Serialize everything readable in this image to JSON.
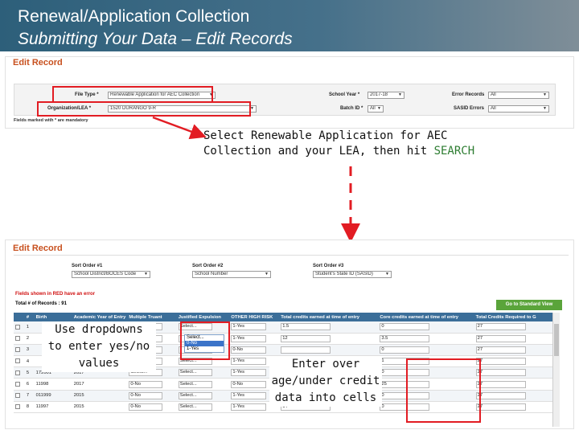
{
  "header": {
    "title": "Renewal/Application Collection",
    "subtitle": "Submitting Your Data – Edit Records"
  },
  "top": {
    "title": "Edit Record",
    "file_type_label": "File Type *",
    "file_type_value": "Renewable Application for AEC Collection",
    "org_label": "Organization/LEA *",
    "org_value": "1520 DURANGO 9-R",
    "school_year_label": "School Year *",
    "school_year_value": "2017-18",
    "batch_label": "Batch ID *",
    "batch_value": "All",
    "error_label": "Error Records",
    "error_value": "All",
    "sasid_label": "SASID Errors",
    "sasid_value": "All",
    "mandatory": "Fields marked with * are mandatory"
  },
  "callout": {
    "line1": "Select Renewable Application for AEC",
    "line2_pre": "Collection and your LEA, then hit ",
    "line2_kw": "SEARCH"
  },
  "bottom": {
    "title": "Edit Record",
    "sort1_label": "Sort Order #1",
    "sort1_value": "School District/BOCES Code",
    "sort2_label": "Sort Order #2",
    "sort2_value": "School Number",
    "sort3_label": "Sort Order #3",
    "sort3_value": "Student's State ID (SASID)",
    "err_msg": "Fields shown in RED have an error",
    "total": "Total # of Records : 91",
    "std_btn": "Go to Standard View",
    "columns": [
      "",
      "#",
      "Birth",
      "Academic Year of Entry",
      "Multiple Truant",
      "Justified Expulsion",
      "OTHER HIGH RISK",
      "Total credits earned at time of entry",
      "Core credits earned at time of entry",
      "Total Credits Required to G"
    ],
    "dropdown_options": [
      "Select...",
      "Select...",
      "0-No",
      "1-Yes"
    ],
    "rows": [
      {
        "n": "1",
        "birth": "",
        "year": "",
        "truant": "",
        "expul": "Select...",
        "risk": "1-Yes",
        "tot": "1.5",
        "core": "0",
        "req": "27"
      },
      {
        "n": "2",
        "birth": "",
        "year": "",
        "truant": "",
        "expul": "",
        "risk": "1-Yes",
        "tot": "12",
        "core": "3.5",
        "req": "27"
      },
      {
        "n": "3",
        "birth": "",
        "year": "",
        "truant": "",
        "expul": "",
        "risk": "0-No",
        "tot": "",
        "core": "0",
        "req": "27"
      },
      {
        "n": "4",
        "birth": "",
        "year": "",
        "truant": "",
        "expul": "Select...",
        "risk": "1-Yes",
        "tot": "",
        "core": "1",
        "req": "27"
      },
      {
        "n": "5",
        "birth": "172001",
        "year": "2017",
        "truant": "Select...",
        "expul": "Select...",
        "risk": "1-Yes",
        "tot": "",
        "core": "0",
        "req": "27"
      },
      {
        "n": "6",
        "birth": "11998",
        "year": "2017",
        "truant": "0-No",
        "expul": "Select...",
        "risk": "0-No",
        "tot": "",
        "core": "25",
        "req": "27"
      },
      {
        "n": "7",
        "birth": "011999",
        "year": "2015",
        "truant": "0-No",
        "expul": "Select...",
        "risk": "1-Yes",
        "tot": "",
        "core": "0",
        "req": "27"
      },
      {
        "n": "8",
        "birth": "11997",
        "year": "2015",
        "truant": "0-No",
        "expul": "Select...",
        "risk": "1-Yes",
        "tot": "14",
        "core": "0",
        "req": "27"
      }
    ]
  },
  "notes": {
    "dropdowns": [
      "Use dropdowns",
      "to enter yes/no",
      "values"
    ],
    "credits": [
      "Enter over",
      "age/under credit",
      "data into cells"
    ]
  },
  "colors": {
    "accent_red": "#e21c23",
    "header": "#2d5f7a",
    "table_header": "#3b6e99",
    "title_orange": "#c8501e",
    "search_green": "#2e7d32"
  }
}
